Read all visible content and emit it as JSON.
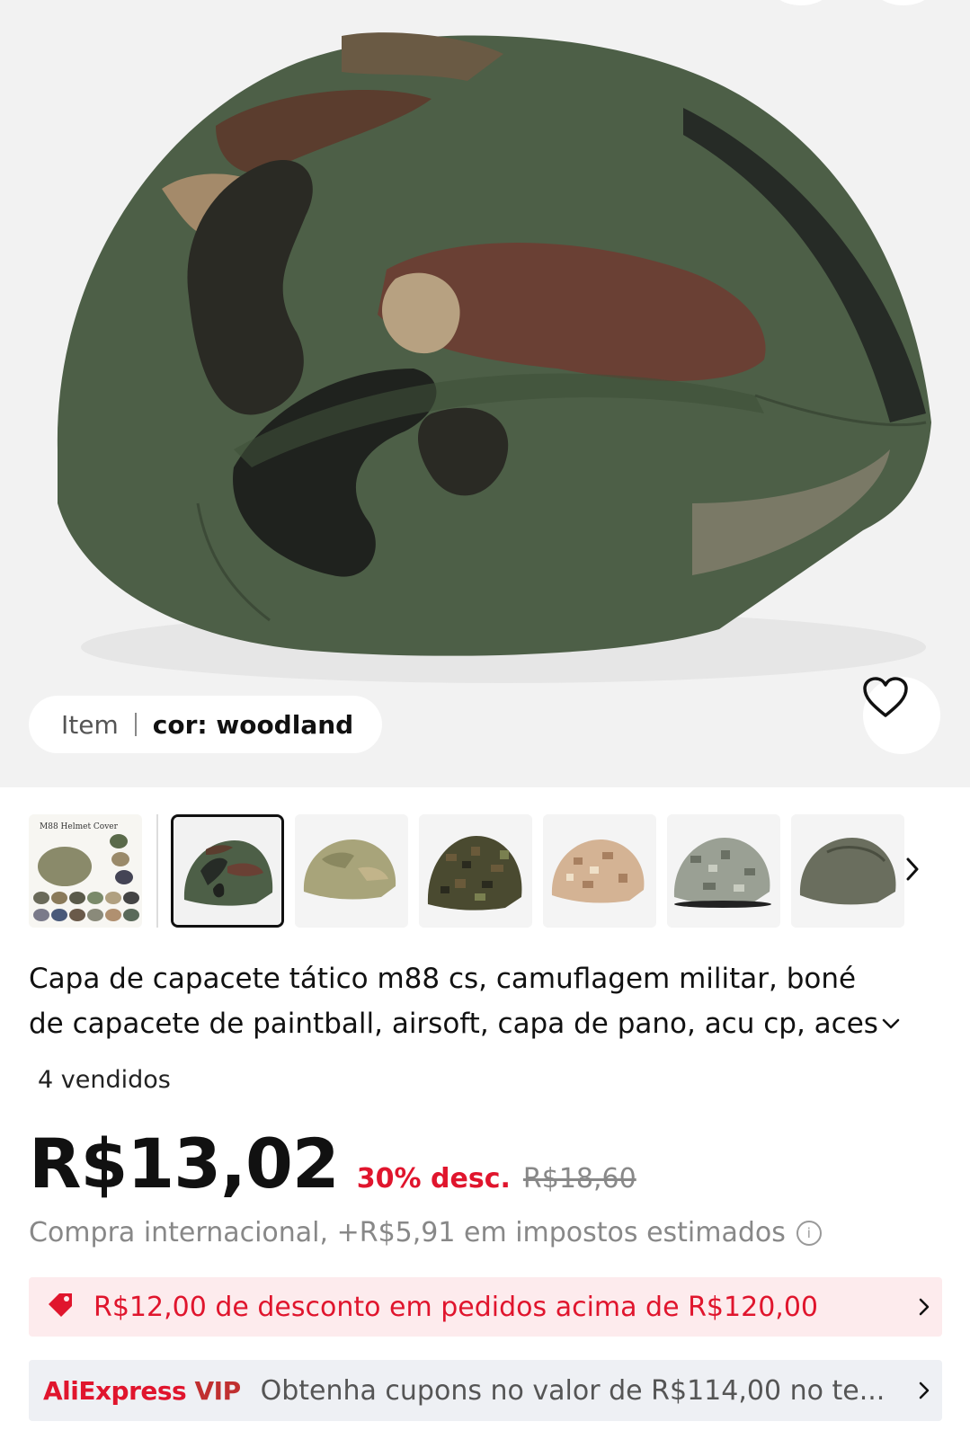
{
  "variant": {
    "label": "Item",
    "value": "cor: woodland"
  },
  "thumbnails": [
    {
      "name": "thumb-m88-helmet-cover-collage",
      "caption": "M88 Helmet Cover"
    },
    {
      "name": "thumb-woodland",
      "caption": ""
    },
    {
      "name": "thumb-desert-digital",
      "caption": ""
    },
    {
      "name": "thumb-digital-woodland",
      "caption": ""
    },
    {
      "name": "thumb-desert-digital-tan",
      "caption": ""
    },
    {
      "name": "thumb-acu",
      "caption": ""
    },
    {
      "name": "thumb-olive-green",
      "caption": ""
    }
  ],
  "product": {
    "title_line1": "Capa de capacete tático m88 cs, camuflagem militar, boné",
    "title_line2": "de capacete de paintball, airsoft, capa de pano, acu cp, aces",
    "sold": "4 vendidos",
    "price": "R$13,02",
    "discount": "30% desc.",
    "original_price": "R$18,60",
    "tax_note": "Compra internacional, +R$5,91 em impostos estimados"
  },
  "coupon": {
    "text": "R$12,00 de desconto em pedidos acima de R$120,00"
  },
  "vip": {
    "brand_ali": "AliExpress",
    "brand_vip": "VIP",
    "text": "Obtenha cupons no valor de R$114,00 no te..."
  },
  "colors": {
    "accent": "#e0152d",
    "coupon_bg": "#fdebed",
    "vip_bg": "#eef0f4"
  },
  "icons": [
    "heart-icon",
    "chevron-right-icon",
    "chevron-down-icon",
    "info-icon",
    "coupon-tag-icon"
  ]
}
